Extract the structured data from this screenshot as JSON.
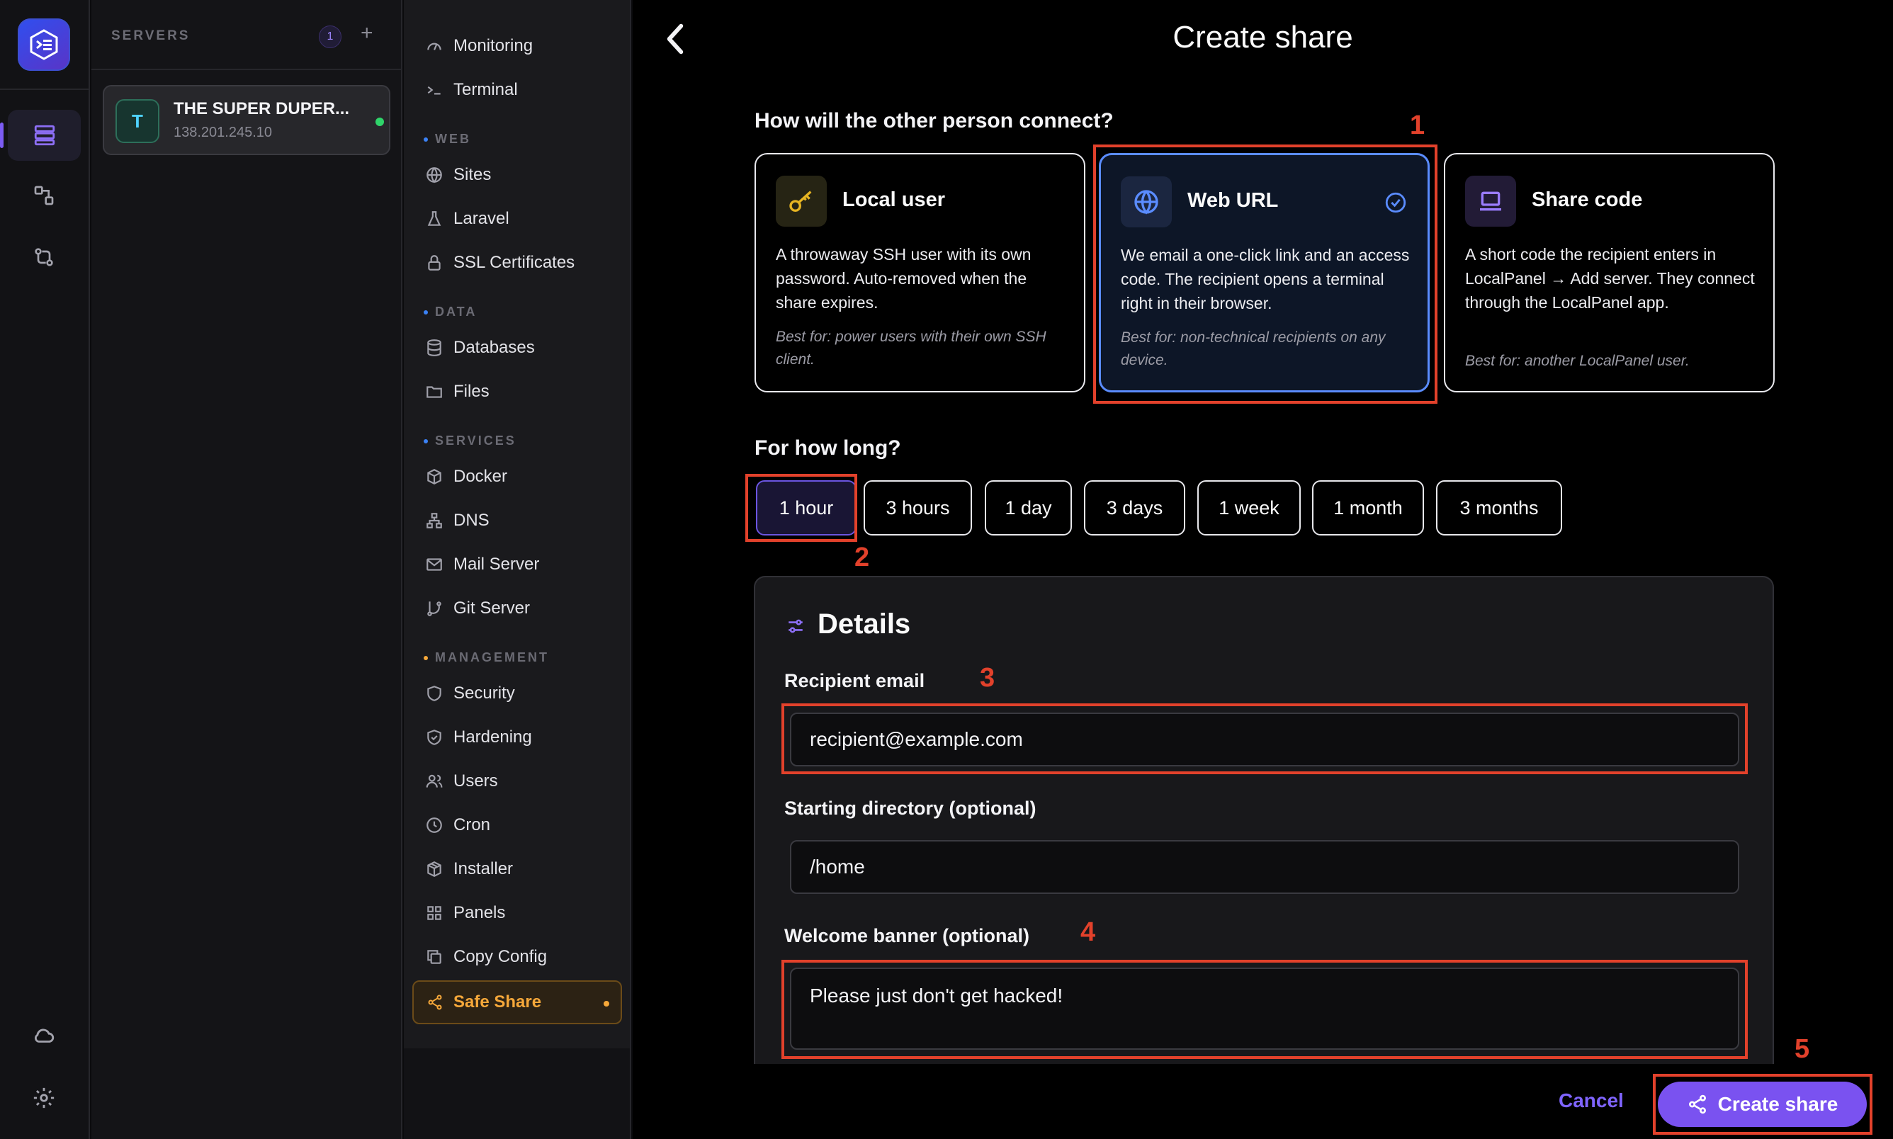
{
  "servers": {
    "header": "SERVERS",
    "count": "1",
    "add": "+",
    "items": [
      {
        "initial": "T",
        "name": "THE SUPER DUPER...",
        "ip": "138.201.245.10",
        "status_color": "#2fd46a"
      }
    ]
  },
  "nav": {
    "top": [
      {
        "label": "Monitoring",
        "icon": "gauge-icon"
      },
      {
        "label": "Terminal",
        "icon": "terminal-icon"
      }
    ],
    "sections": [
      {
        "title": "WEB",
        "color": "#3b82f6",
        "items": [
          {
            "label": "Sites",
            "icon": "globe-icon"
          },
          {
            "label": "Laravel",
            "icon": "flask-icon"
          },
          {
            "label": "SSL Certificates",
            "icon": "lock-icon"
          }
        ]
      },
      {
        "title": "DATA",
        "color": "#3b82f6",
        "items": [
          {
            "label": "Databases",
            "icon": "database-icon"
          },
          {
            "label": "Files",
            "icon": "folder-icon"
          }
        ]
      },
      {
        "title": "SERVICES",
        "color": "#3b82f6",
        "items": [
          {
            "label": "Docker",
            "icon": "box-icon"
          },
          {
            "label": "DNS",
            "icon": "network-icon"
          },
          {
            "label": "Mail Server",
            "icon": "mail-icon"
          },
          {
            "label": "Git Server",
            "icon": "git-branch-icon"
          }
        ]
      },
      {
        "title": "MANAGEMENT",
        "color": "#f6a83a",
        "items": [
          {
            "label": "Security",
            "icon": "shield-icon"
          },
          {
            "label": "Hardening",
            "icon": "shield-check-icon"
          },
          {
            "label": "Users",
            "icon": "users-icon"
          },
          {
            "label": "Cron",
            "icon": "clock-icon"
          },
          {
            "label": "Installer",
            "icon": "package-icon"
          },
          {
            "label": "Panels",
            "icon": "grid-icon"
          },
          {
            "label": "Copy Config",
            "icon": "copy-icon"
          }
        ]
      }
    ],
    "active": {
      "label": "Safe Share",
      "icon": "share-icon",
      "color": "#f6a83a"
    }
  },
  "page": {
    "title": "Create share",
    "connect_question": "How will the other person connect?",
    "options": [
      {
        "title": "Local user",
        "desc": "A throwaway SSH user with its own password. Auto-removed when the share expires.",
        "best": "Best for: power users with their own SSH client."
      },
      {
        "title": "Web URL",
        "desc": "We email a one-click link and an access code. The recipient opens a terminal right in their browser.",
        "best": "Best for: non-technical recipients on any device.",
        "selected": true
      },
      {
        "title": "Share code",
        "desc": "A short code the recipient enters in LocalPanel → Add server. They connect through the LocalPanel app.",
        "best": "Best for: another LocalPanel user."
      }
    ],
    "duration_question": "For how long?",
    "durations": [
      "1 hour",
      "3 hours",
      "1 day",
      "3 days",
      "1 week",
      "1 month",
      "3 months"
    ],
    "selected_duration": "1 hour",
    "details": {
      "title": "Details",
      "recipient_label": "Recipient email",
      "recipient_value": "recipient@example.com",
      "directory_label": "Starting directory (optional)",
      "directory_value": "/home",
      "banner_label": "Welcome banner (optional)",
      "banner_value": "Please just don't get hacked!"
    },
    "cancel_label": "Cancel",
    "create_label": "Create share"
  },
  "annotations": [
    "1",
    "2",
    "3",
    "4",
    "5"
  ],
  "colors": {
    "accent": "#7a52f0",
    "selected_border": "#5a8cff",
    "annotation": "#e2412b",
    "status": "#2fd46a"
  }
}
